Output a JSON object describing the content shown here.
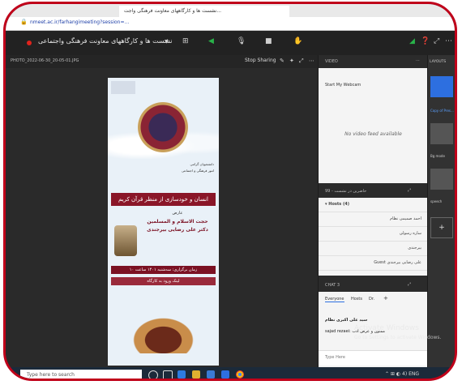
{
  "browser": {
    "tab_title": "نشست ها و کارگاههای معاونت فرهنگی واجت...",
    "url": "nmeet.ac.ir/farhangimeeting?session=..."
  },
  "meeting": {
    "title": "نشست ها و کارگاههای معاونت فرهنگی واجتماعی",
    "title_dropdown": "▼"
  },
  "presentation": {
    "file_name": "PHOTO_2022-06-30_20-05-01.JPG",
    "stop_label": "Stop Sharing",
    "poster": {
      "header_lines": [
        "دانشجویان گرامی",
        "امور فرهنگی و اجتماعی"
      ],
      "title": "انسان و خودسازی از منظر قرآن کریم",
      "presenter_intro": "عارض",
      "presenter_rank": "حجت الاسلام و المسلمین",
      "presenter_name": "دکتر علی رضایی بیرجندی",
      "time_line": "زمان برگزاری: سه‌شنبه ۱۴۰۱ ساعت ۱۰",
      "link_line": "لینک ورود به کارگاه"
    }
  },
  "side": {
    "video_header": "VIDEO",
    "webcam_button": "Start My Webcam",
    "no_video": "No video feed available",
    "attendees_header": "حاضرین در نشست - 99",
    "hosts_header": "Hosts (4)",
    "attendees": [
      "احمد صمیمی نظام",
      "ساره رسولی",
      "بیرجندی",
      "علی رضایی بیرجندی Guest"
    ],
    "chat_header": "CHAT 3",
    "chat_tabs": [
      "Everyone",
      "Hosts",
      "Dr.",
      "+"
    ],
    "messages": [
      "سید علی اکبری نظام",
      "sajad rezaei: ممنون و عرض ادب"
    ],
    "chat_placeholder": "Type Here"
  },
  "layouts": {
    "header": "LAYOUTS",
    "items": [
      "Copy of Pres...",
      "Bg mode",
      "speech"
    ],
    "add": "+"
  },
  "watermark": {
    "line1": "Activate Windows",
    "line2": "Go to Settings to activate Windows."
  },
  "taskbar": {
    "search_placeholder": "Type here to search",
    "tray_text": "⌃ ⊞ ◐ 4) ENG"
  },
  "colors": {
    "frame": "#c0001a",
    "dark": "#2b2b2b",
    "accent_blue": "#2d6fe0",
    "record": "#e0231c"
  }
}
